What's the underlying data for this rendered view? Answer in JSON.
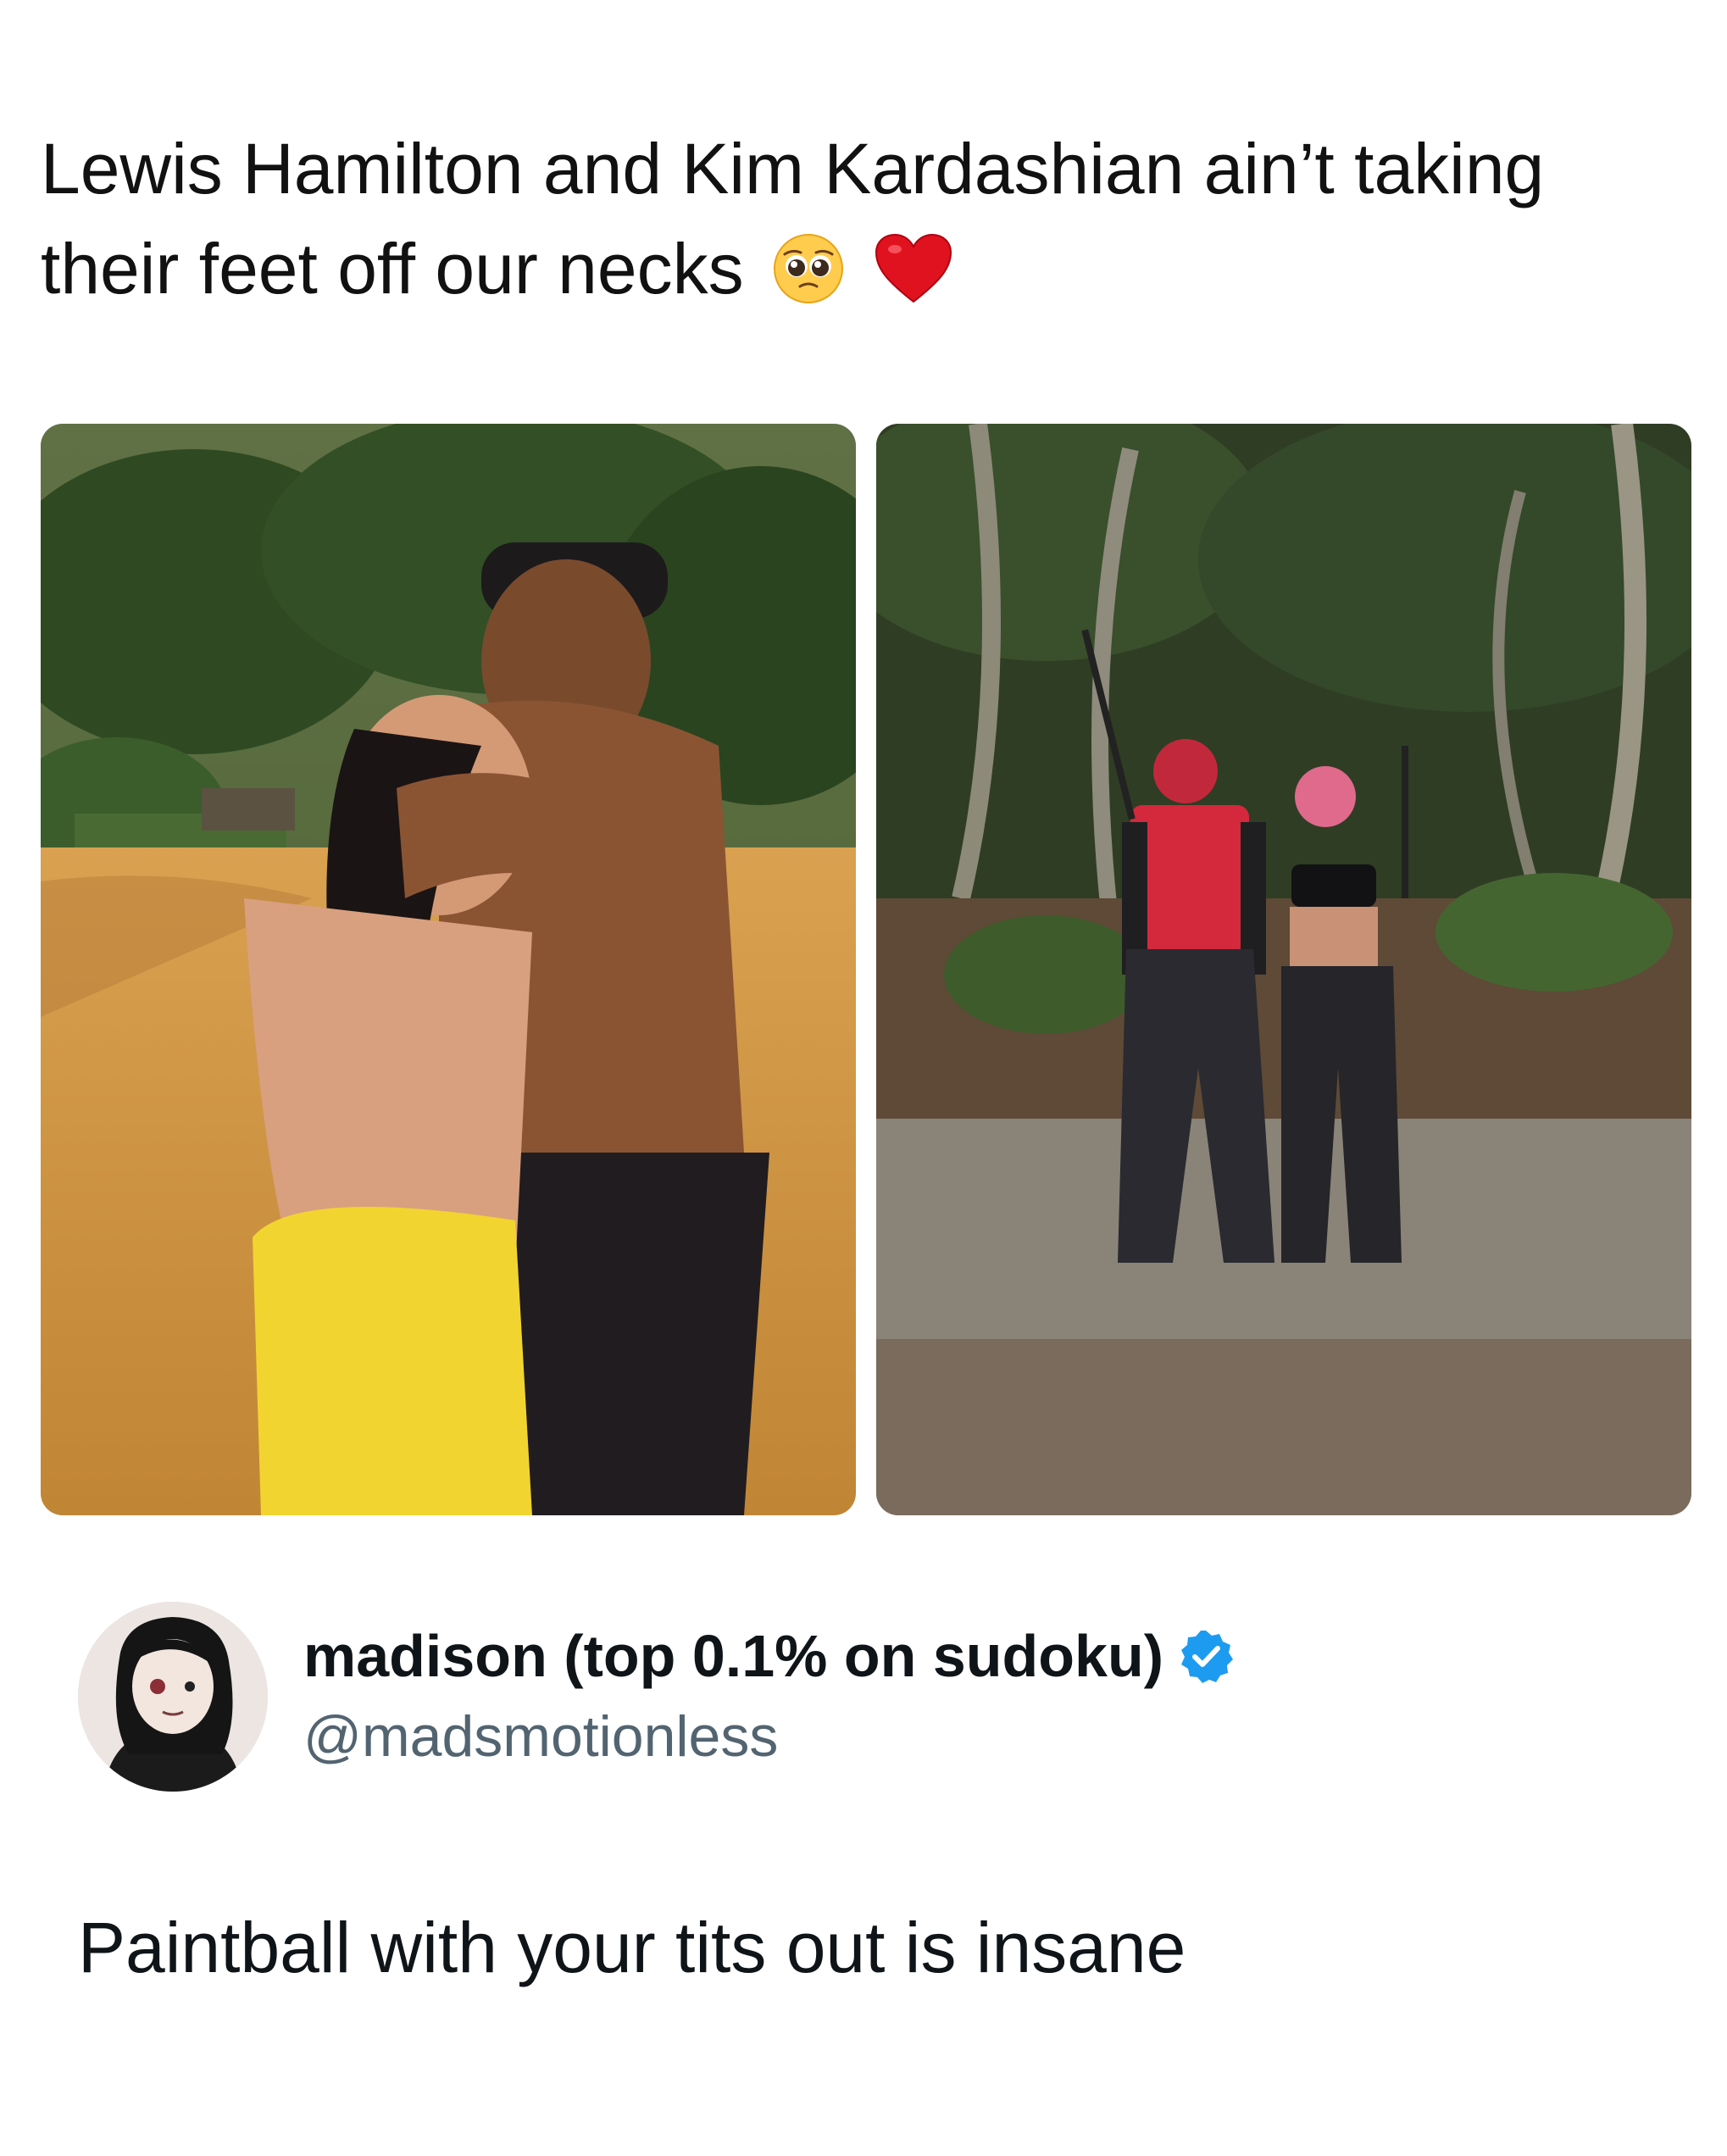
{
  "post": {
    "headline_line1": "Lewis Hamilton and Kim Kardashian ain’t taking",
    "headline_line2": "their feet off our necks",
    "headline_emojis": [
      "pleading-face-icon",
      "red-heart-icon"
    ]
  },
  "images": [
    {
      "name": "beach-photo",
      "scene": "beach-embrace"
    },
    {
      "name": "paintball-photo",
      "scene": "paintball-forest"
    }
  ],
  "tweet": {
    "display_name": "madison (top 0.1% on sudoku)",
    "verified": true,
    "handle": "@madsmotionless",
    "text": "Paintball with your tits out is insane",
    "verified_color": "#1d9bf0"
  },
  "colors": {
    "name_text": "#0f1419",
    "handle_text": "#536471",
    "background": "#ffffff"
  }
}
